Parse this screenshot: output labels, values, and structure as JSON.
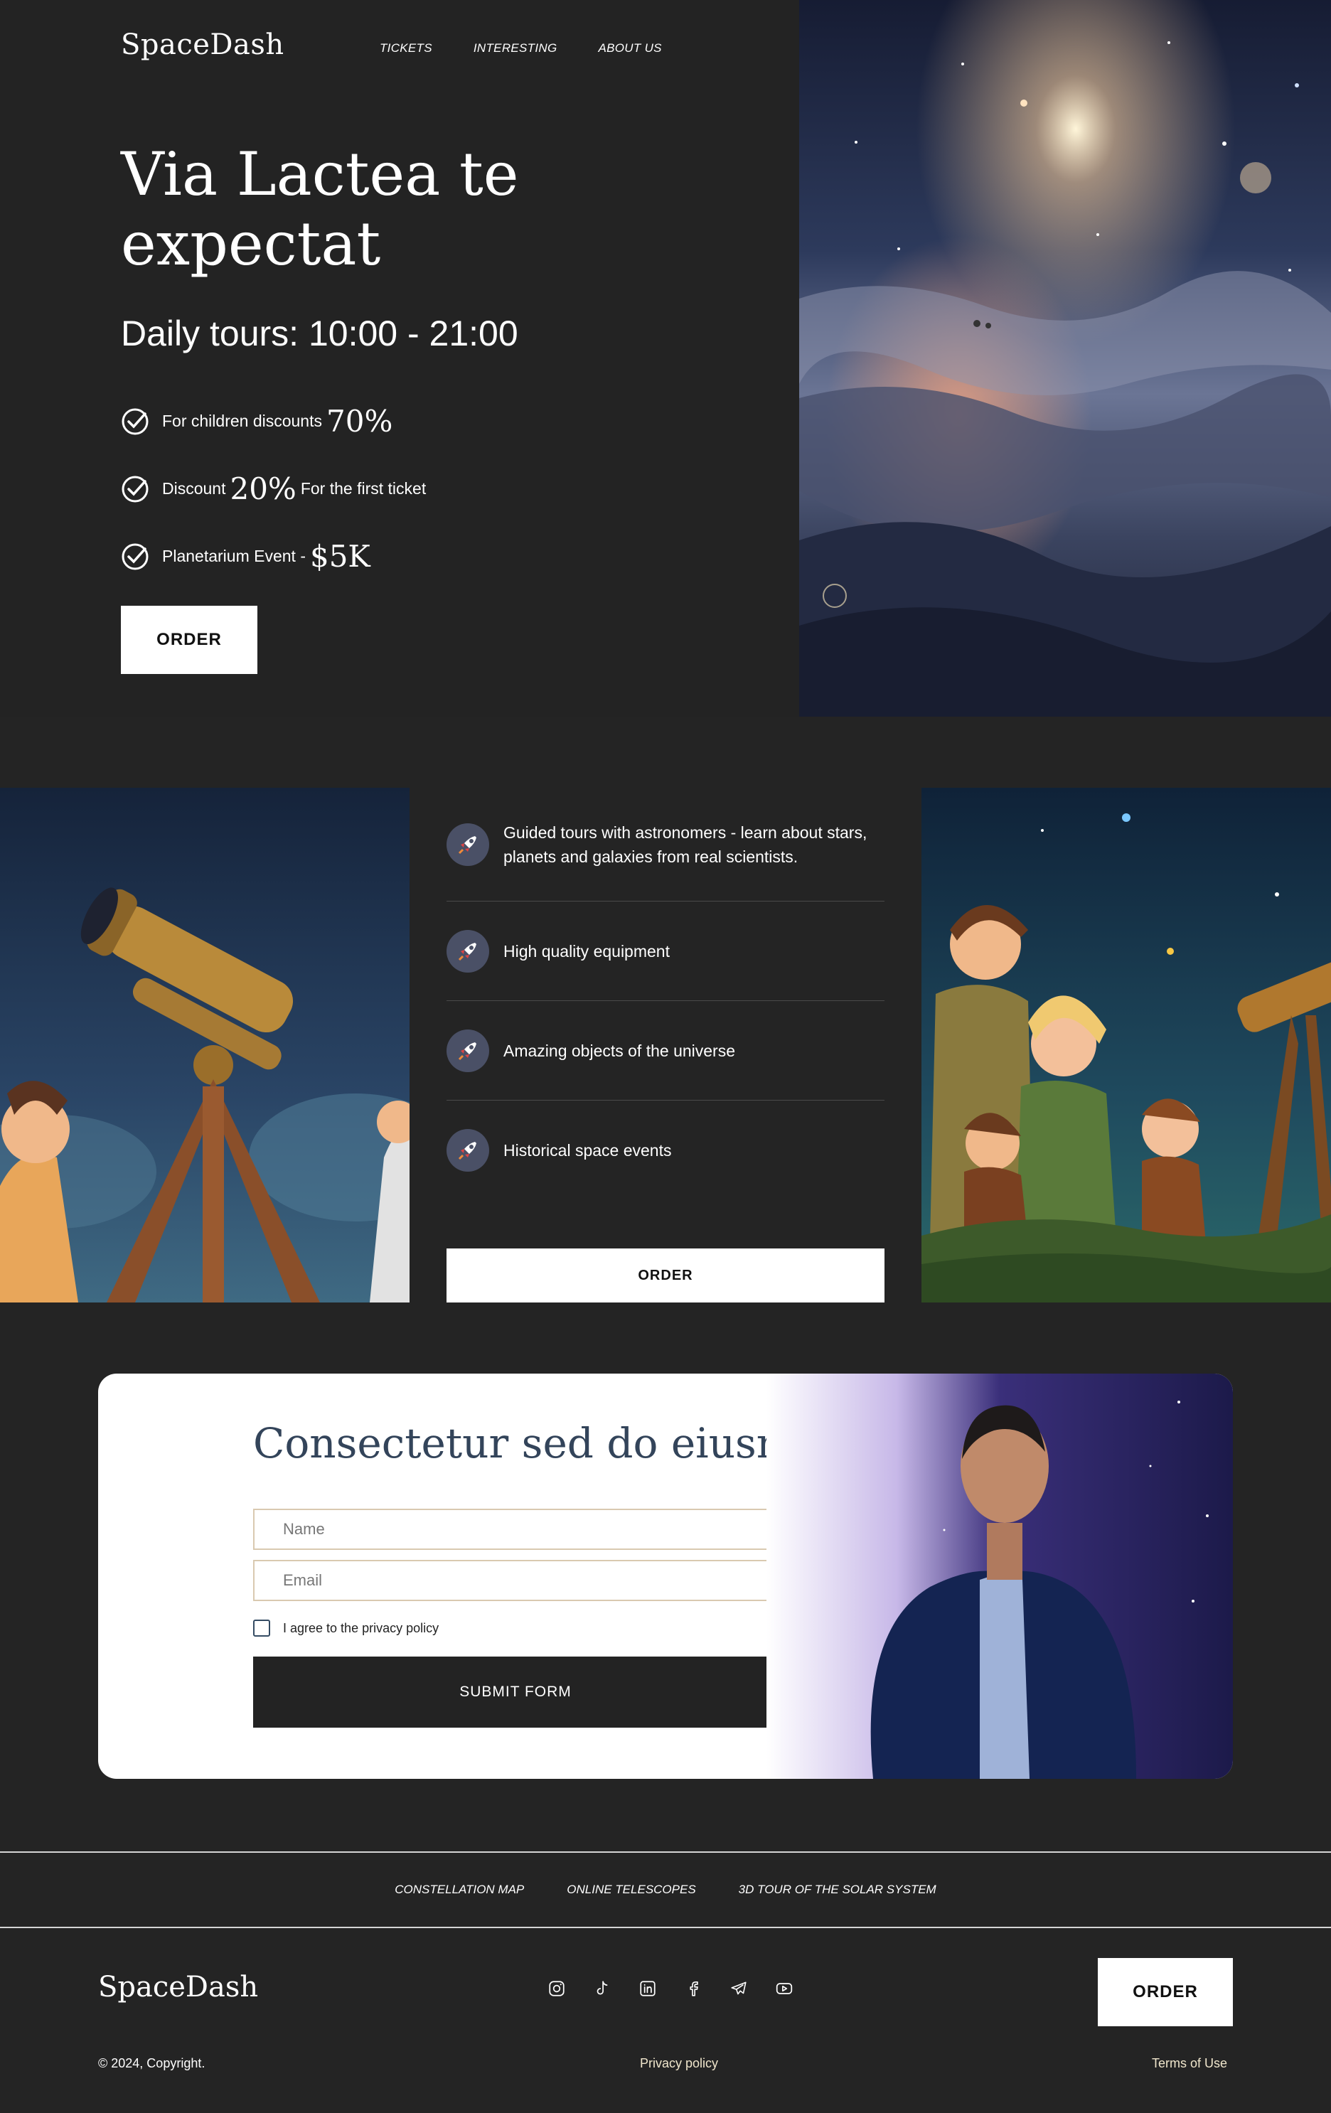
{
  "brand": "SpaceDash",
  "nav": [
    "TICKETS",
    "INTERESTING",
    "ABOUT US"
  ],
  "hero": {
    "title_line1": "Via Lactea te",
    "title_line2": "expectat",
    "hours": "Daily tours: 10:00 - 21:00",
    "features": [
      {
        "pre": "For children discounts",
        "big": "70%",
        "post": ""
      },
      {
        "pre": "Discount",
        "big": "20%",
        "post": "For the first ticket"
      },
      {
        "pre": "Planetarium Event -",
        "big": "$5K",
        "post": ""
      }
    ],
    "order": "ORDER"
  },
  "features": {
    "items": [
      "Guided tours with astronomers - learn about stars, planets and galaxies from real scientists.",
      "High quality equipment",
      "Amazing objects of the universe",
      "Historical space events"
    ],
    "order": "ORDER"
  },
  "form": {
    "title": "Consectetur sed do eiusmod",
    "name_placeholder": "Name",
    "email_placeholder": "Email",
    "agree": "I agree to the privacy policy",
    "submit": "SUBMIT FORM"
  },
  "links": [
    "CONSTELLATION MAP",
    "ONLINE TELESCOPES",
    "3D TOUR OF THE SOLAR SYSTEM"
  ],
  "footer": {
    "brand": "SpaceDash",
    "order": "ORDER",
    "copyright": "© 2024, Copyright.",
    "privacy": "Privacy policy",
    "terms": "Terms of Use",
    "socials": [
      "instagram-icon",
      "tiktok-icon",
      "linkedin-icon",
      "facebook-icon",
      "telegram-icon",
      "youtube-icon"
    ]
  }
}
